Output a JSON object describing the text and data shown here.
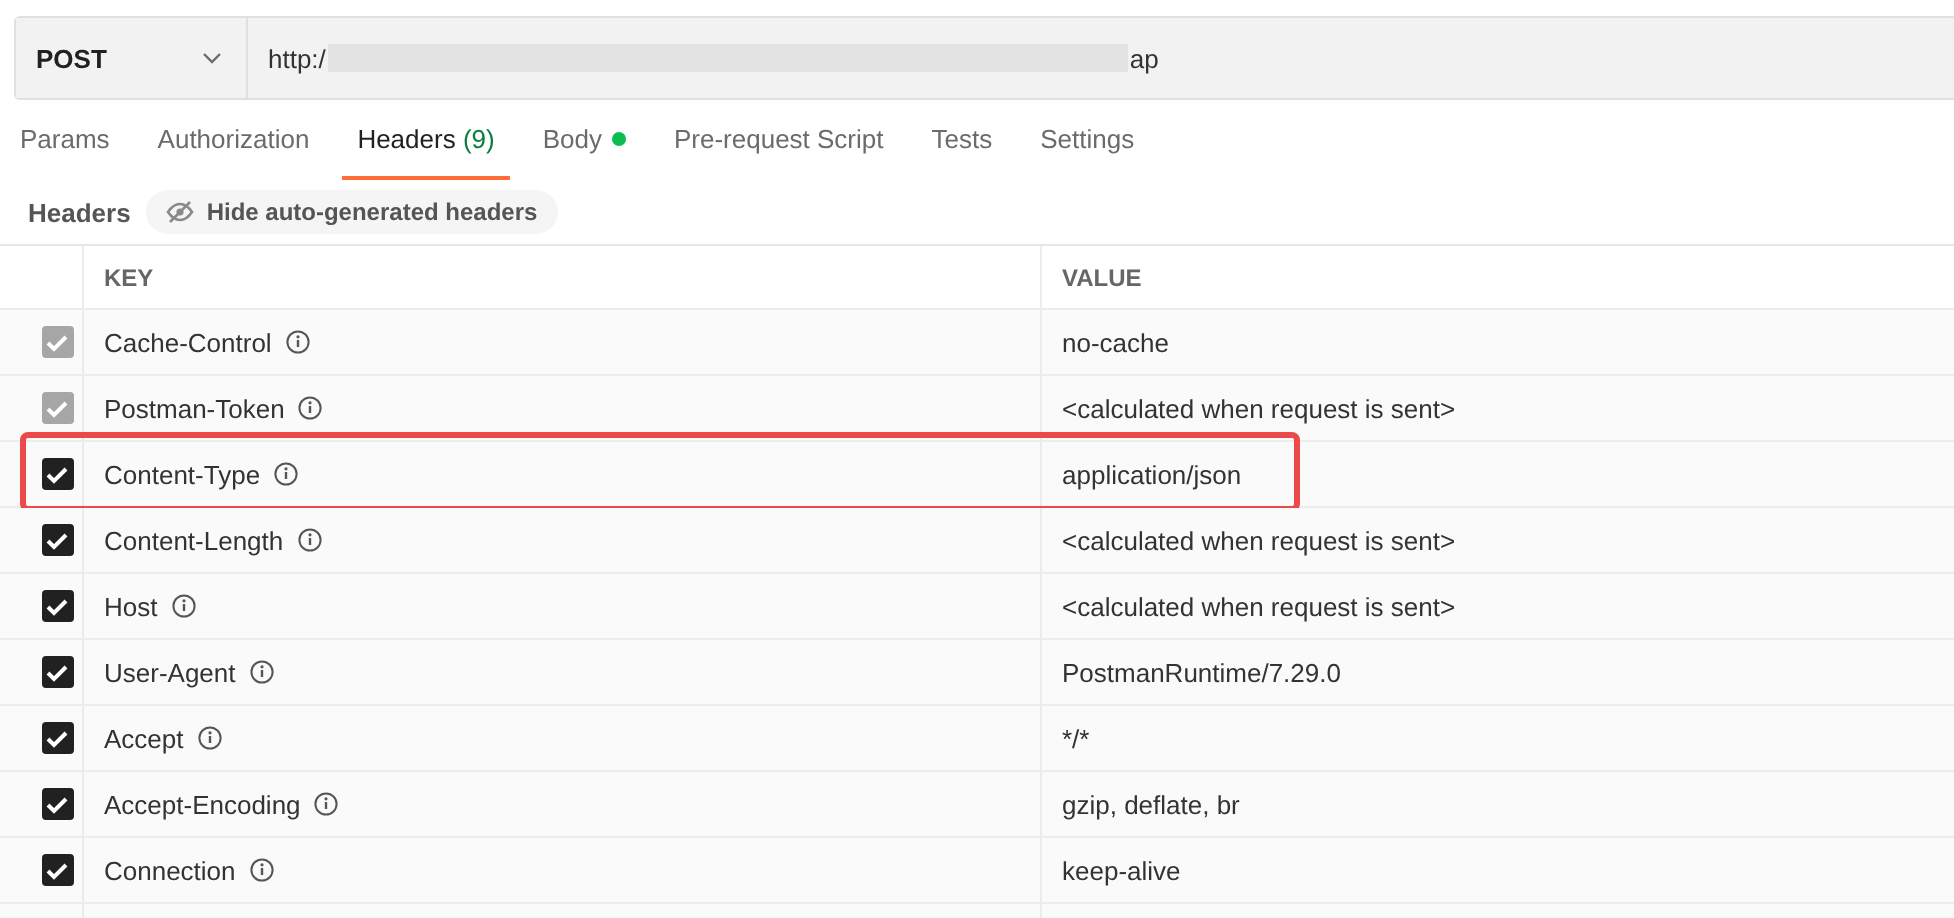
{
  "request": {
    "method": "POST",
    "url_start": "http:/",
    "url_end": "ap",
    "url_redacted": true
  },
  "tabs": [
    {
      "label": "Params",
      "selected": false
    },
    {
      "label": "Authorization",
      "selected": false
    },
    {
      "label": "Headers",
      "count": "(9)",
      "selected": true
    },
    {
      "label": "Body",
      "has_content": true,
      "selected": false
    },
    {
      "label": "Pre-request Script",
      "selected": false
    },
    {
      "label": "Tests",
      "selected": false
    },
    {
      "label": "Settings",
      "selected": false
    }
  ],
  "headers_bar": {
    "label": "Headers",
    "toggle": "Hide auto-generated headers"
  },
  "table": {
    "columns": [
      "KEY",
      "VALUE"
    ],
    "rows": [
      {
        "key": "Cache-Control",
        "value": "no-cache",
        "checked": true,
        "disabled": true,
        "highlighted": false
      },
      {
        "key": "Postman-Token",
        "value": "<calculated when request is sent>",
        "checked": true,
        "disabled": true,
        "highlighted": false
      },
      {
        "key": "Content-Type",
        "value": "application/json",
        "checked": true,
        "disabled": false,
        "highlighted": true
      },
      {
        "key": "Content-Length",
        "value": "<calculated when request is sent>",
        "checked": true,
        "disabled": false,
        "highlighted": false
      },
      {
        "key": "Host",
        "value": "<calculated when request is sent>",
        "checked": true,
        "disabled": false,
        "highlighted": false
      },
      {
        "key": "User-Agent",
        "value": "PostmanRuntime/7.29.0",
        "checked": true,
        "disabled": false,
        "highlighted": false
      },
      {
        "key": "Accept",
        "value": "*/*",
        "checked": true,
        "disabled": false,
        "highlighted": false
      },
      {
        "key": "Accept-Encoding",
        "value": "gzip, deflate, br",
        "checked": true,
        "disabled": false,
        "highlighted": false
      },
      {
        "key": "Connection",
        "value": "keep-alive",
        "checked": true,
        "disabled": false,
        "highlighted": false
      }
    ]
  }
}
